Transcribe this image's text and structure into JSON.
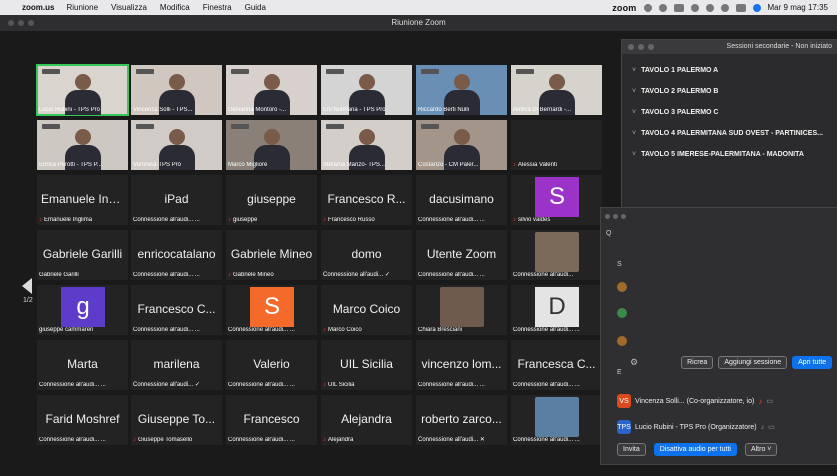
{
  "menubar": {
    "app": "zoom.us",
    "items": [
      "Riunione",
      "Visualizza",
      "Modifica",
      "Finestra",
      "Guida"
    ],
    "zoom_logo": "zoom",
    "datetime": "Mar 9 mag 17:35"
  },
  "window": {
    "title": "Riunione Zoom"
  },
  "gallery": {
    "page": "1/2",
    "video_tiles": [
      {
        "name": "Lucio Rubini - TPS Pro",
        "highlight": true,
        "bg": "#d9d4ce"
      },
      {
        "name": "Vincenza Solli - TPS...",
        "highlight": false,
        "bg": "#cfc7c0"
      },
      {
        "name": "Giovanna Montoro -...",
        "highlight": false,
        "bg": "#d8d0cc"
      },
      {
        "name": "Eni Nurihana - TPS Pro",
        "highlight": false,
        "bg": "#d4d4d4"
      },
      {
        "name": "Riccardo Berti Nulli",
        "highlight": false,
        "bg": "#6a8fb5"
      },
      {
        "name": "Ambra Di Bernardi -...",
        "highlight": false,
        "bg": "#d6d2cc"
      },
      {
        "name": "Enrica Perotti - TPS P...",
        "highlight": false,
        "bg": "#cec8c2"
      },
      {
        "name": "Veronica-TPS Pro",
        "highlight": false,
        "bg": "#d0cbc6"
      },
      {
        "name": "Marco Migliore",
        "highlight": false,
        "bg": "#8a8078"
      },
      {
        "name": "Stefania Manzo- TPS...",
        "highlight": false,
        "bg": "#d4ceca"
      },
      {
        "name": "Costanzo - CM Paler...",
        "highlight": false,
        "bg": "#a3958a"
      }
    ],
    "name_tiles": [
      {
        "big": "",
        "name": "Alessia Valenti",
        "muted": true
      },
      {
        "big": "Emanuele Ing...",
        "name": "Emanuele Inglima",
        "muted": true
      },
      {
        "big": "iPad",
        "name": "Connessione all'audi... ...",
        "muted": false
      },
      {
        "big": "giuseppe",
        "name": "giuseppe",
        "muted": true
      },
      {
        "big": "Francesco R...",
        "name": "Francesco Russo",
        "muted": true
      },
      {
        "big": "dacusimano",
        "name": "Connessione all'audi... ...",
        "muted": false
      },
      {
        "big": "Gabriele Garilli",
        "name": "Gabriele Garilli",
        "muted": false
      },
      {
        "big": "enricocatalano",
        "name": "Connessione all'audi... ...",
        "muted": false
      },
      {
        "big": "Gabriele Mineo",
        "name": "Gabriele Mineo",
        "muted": true
      },
      {
        "big": "domo",
        "name": "Connessione all'audi... ✓",
        "muted": false
      },
      {
        "big": "Utente Zoom",
        "name": "Connessione all'audi... ...",
        "muted": false
      },
      {
        "big": "Francesco C...",
        "name": "Connessione all'audi... ...",
        "muted": false
      },
      {
        "big": "Marco Coico",
        "name": "Marco Coico",
        "muted": true
      },
      {
        "big": "Marta",
        "name": "Connessione all'audi... ...",
        "muted": false
      },
      {
        "big": "marilena",
        "name": "Connessione all'audi... ✓",
        "muted": false
      },
      {
        "big": "Valerio",
        "name": "Connessione all'audi... ...",
        "muted": false
      },
      {
        "big": "UIL Sicilia",
        "name": "UIL Sicilia",
        "muted": true
      },
      {
        "big": "vincenzo lom...",
        "name": "Connessione all'audi... ...",
        "muted": false
      },
      {
        "big": "Francesca C...",
        "name": "Connessione all'audi... ...",
        "muted": false
      },
      {
        "big": "Farid Moshref",
        "name": "Connessione all'audi... ...",
        "muted": false
      },
      {
        "big": "Giuseppe To...",
        "name": "Giuseppe Tomasello",
        "muted": true
      },
      {
        "big": "Francesco",
        "name": "Connessione all'audi... ...",
        "muted": false
      },
      {
        "big": "Alejandra",
        "name": "Alejandra",
        "muted": true
      },
      {
        "big": "roberto zarco...",
        "name": "Connessione all'audi... ✕",
        "muted": false
      }
    ],
    "avatar_tiles": [
      {
        "letter": "S",
        "color": "#9b33c9",
        "name": "silvio valdes",
        "muted": true
      },
      {
        "letter": "g",
        "color": "#5c3cc9",
        "name": "giuseppe cammareri",
        "muted": false
      },
      {
        "letter": "S",
        "color": "#f36a2a",
        "name": "Connessione all'audi... ...",
        "muted": false
      },
      {
        "letter": "D",
        "color": "#e4e4e4",
        "name": "Connessione all'audi... ...",
        "muted": false
      }
    ],
    "photo_tiles": [
      {
        "name": "Connessione all'audi...",
        "bg": "#7b6a5a"
      },
      {
        "name": "Chiara Bresciani",
        "bg": "#6e5b4d"
      },
      {
        "name": "Connessione all'audi... ...",
        "bg": "#5a7fa3"
      }
    ]
  },
  "breakout": {
    "title": "Sessioni secondarie - Non iniziato",
    "rooms": [
      "TAVOLO 1 PALERMO A",
      "TAVOLO 2 PALERMO B",
      "TAVOLO 3 PALERMO C",
      "TAVOLO 4 PALERMITANA SUD OVEST - PARTINICES...",
      "TAVOLO 5 IMERESE-PALERMITANA - MADONITA"
    ],
    "recreate": "Ricrea",
    "add_session": "Aggiungi sessione",
    "open_all": "Apri tutte"
  },
  "participants": {
    "search_hint": "Q",
    "s_label": "S",
    "en_label": "E",
    "rows": [
      {
        "initials": "VS",
        "color": "#d94a1e",
        "text": "Vincenza Solli...  (Co-organizzatore, io)"
      },
      {
        "initials": "TPS",
        "color": "#2a63c9",
        "text": "Lucio Rubini - TPS Pro (Organizzatore)"
      }
    ],
    "invite": "Invita",
    "mute_all": "Disattiva audio per tutti",
    "more": "Altro ˅"
  }
}
